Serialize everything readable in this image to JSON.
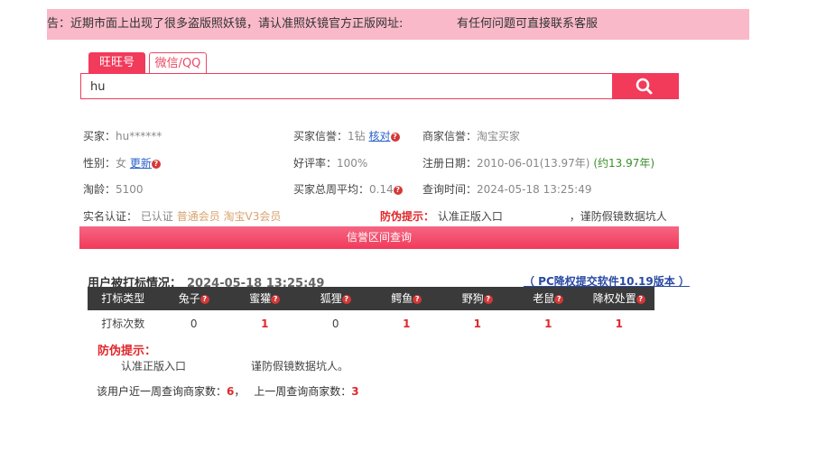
{
  "notice": {
    "left_text": "告：近期市面上出现了很多盗版照妖镜，请认准照妖镜官方正版网址:",
    "right_text": "有任何问题可直接联系客服"
  },
  "tabs": [
    {
      "label": "旺旺号"
    },
    {
      "label": "微信/QQ"
    }
  ],
  "search": {
    "value": "hu"
  },
  "profile": {
    "buyer_label": "买家：",
    "buyer_value": "hu******",
    "gender_label": "性别：",
    "gender_value": "女",
    "gender_update": "更新",
    "age_label": "淘龄：",
    "age_value": "5100",
    "buyer_credit_label": "买家信誉：",
    "buyer_credit_value": "1钻",
    "buyer_credit_verify": "核对",
    "good_rate_label": "好评率：",
    "good_rate_value": "100%",
    "avg_label": "买家总周平均：",
    "avg_value": "0.14",
    "seller_credit_label": "商家信誉：",
    "seller_credit_value": "淘宝买家",
    "reg_label": "注册日期：",
    "reg_value": "2010-06-01(13.97年)",
    "reg_approx": "(约13.97年)",
    "query_time_label": "查询时间：",
    "query_time_value": "2024-05-18 13:25:49",
    "realname_label": "实名认证：",
    "realname_value": "已认证",
    "member_1": "普通会员",
    "member_2": "淘宝V3会员",
    "antifake_label": "防伪提示：",
    "antifake_1": "认准正版入口",
    "antifake_2": "，谨防假镜数据坑人"
  },
  "credit_bar": {
    "label": "信誉区间查询"
  },
  "history": {
    "title": "用户被打标情况：",
    "time": "2024-05-18 13:25:49",
    "pc_link": "（ PC降权提交软件10.19版本 ）",
    "columns": [
      "打标类型",
      "兔子",
      "蜜獾",
      "狐狸",
      "鳄鱼",
      "野狗",
      "老鼠",
      "降权处置"
    ],
    "row_label": "打标次数",
    "row_values": [
      "0",
      "1",
      "0",
      "1",
      "1",
      "1",
      "1"
    ]
  },
  "warn": {
    "title": "防伪提示：",
    "line1": "认准正版入口",
    "line2": "谨防假镜数据坑人。"
  },
  "counts": {
    "week_label": "该用户近一周查询商家数：",
    "week_value": "6",
    "sep": "，",
    "last_week_label": "上一周查询商家数：",
    "last_week_value": "3"
  },
  "colors": {
    "accent": "#f23a5a",
    "notice_bg": "#f9b9c9",
    "table_header": "#3a3a3a"
  }
}
